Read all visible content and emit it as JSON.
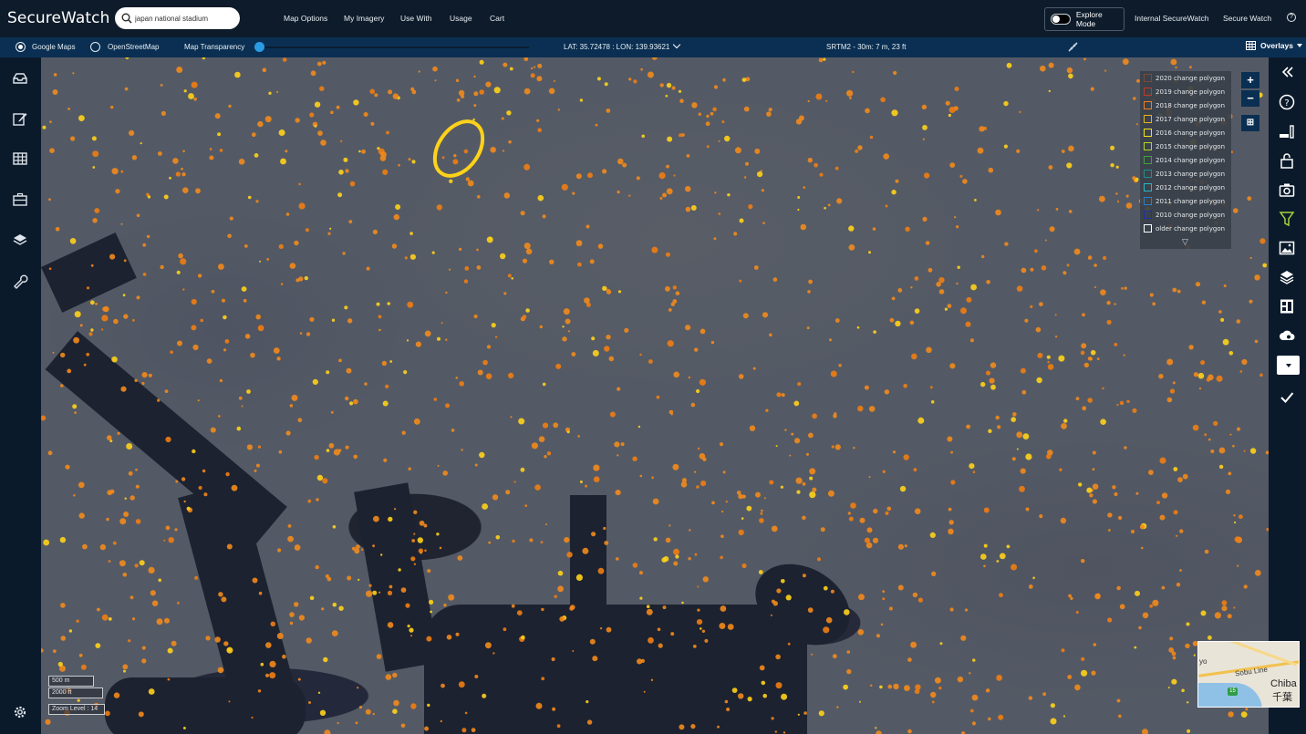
{
  "app": {
    "title": "SecureWatch"
  },
  "search": {
    "value": "japan national stadium",
    "placeholder": "Search"
  },
  "nav": {
    "items": [
      "Map Options",
      "My Imagery",
      "Use With",
      "Usage",
      "Cart"
    ],
    "explore_mode": "Explore Mode",
    "internal": "Internal SecureWatch",
    "secure": "Secure Watch",
    "help": "?"
  },
  "subbar": {
    "google": "Google Maps",
    "osm": "OpenStreetMap",
    "transparency": "Map Transparency",
    "transparency_value": 0,
    "coords": "LAT: 35.72478 : LON: 139.93621",
    "elevation": "SRTM2 - 30m: 7 m, 23 ft",
    "overlays": "Overlays"
  },
  "legend": {
    "items": [
      {
        "label": "2020 change polygon",
        "color": "#7a4a3c"
      },
      {
        "label": "2019 change polygon",
        "color": "#c0392b"
      },
      {
        "label": "2018 change polygon",
        "color": "#f07f1a"
      },
      {
        "label": "2017 change polygon",
        "color": "#e8b21a"
      },
      {
        "label": "2016 change polygon",
        "color": "#f2e21c"
      },
      {
        "label": "2015 change polygon",
        "color": "#b8d42a"
      },
      {
        "label": "2014 change polygon",
        "color": "#3fa23c"
      },
      {
        "label": "2013 change polygon",
        "color": "#1f8f8a"
      },
      {
        "label": "2012 change polygon",
        "color": "#27b7c9"
      },
      {
        "label": "2011 change polygon",
        "color": "#2c7fc4"
      },
      {
        "label": "2010 change polygon",
        "color": "#1d2fa6"
      },
      {
        "label": "older change polygon",
        "color": "#ffffff"
      }
    ]
  },
  "scale": {
    "meters": "500 m",
    "feet": "2000 ft",
    "zoom": "Zoom Level : 14"
  },
  "minimap": {
    "line": "Sobu Line",
    "city": "Chiba",
    "city_jp": "千葉",
    "route": "15",
    "label_left": "yo"
  },
  "colors": {
    "topbar": "#0d1b2a",
    "subbar": "#0a2f52",
    "accent": "#2b9be3",
    "filter_active": "#a6d23a"
  }
}
